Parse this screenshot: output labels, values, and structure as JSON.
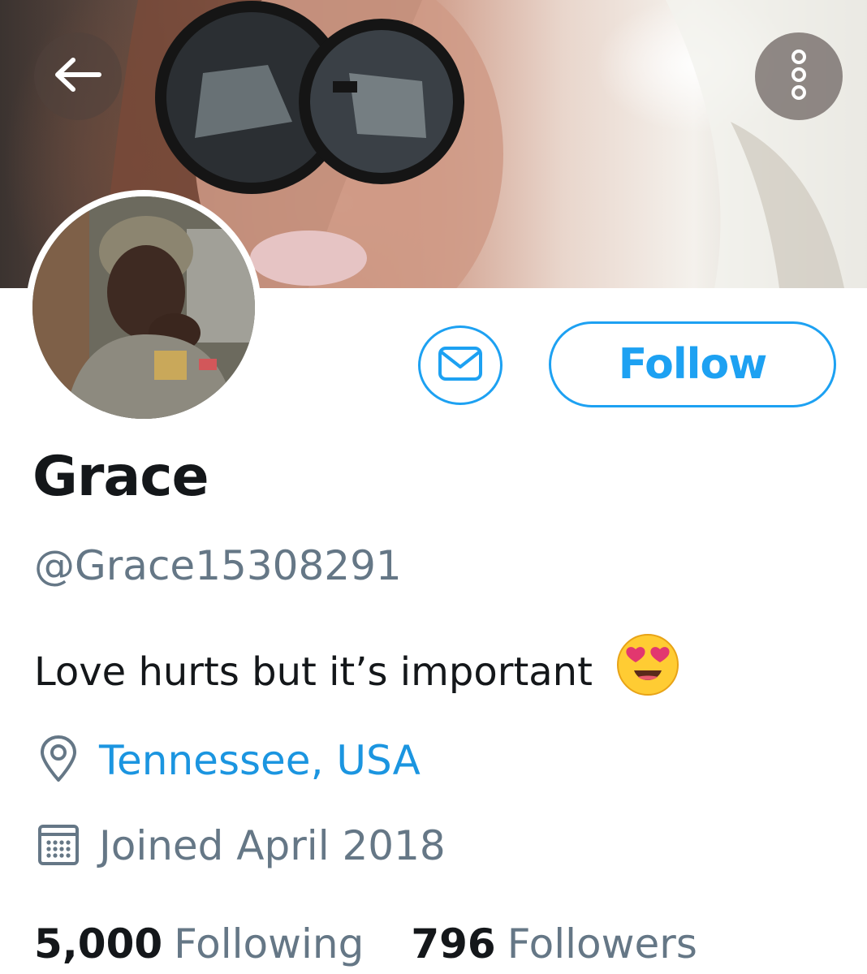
{
  "header": {
    "banner_image": "profile-banner-photo",
    "back_icon": "arrow-left-icon",
    "more_icon": "more-vertical-icon"
  },
  "profile": {
    "avatar_image": "profile-avatar-photo",
    "name": "Grace",
    "handle": "@Grace15308291",
    "bio": "Love hurts but it’s important",
    "bio_emoji_icon": "heart-eyes-emoji-icon",
    "location": "Tennessee, USA",
    "location_icon": "location-pin-icon",
    "joined": "Joined April 2018",
    "joined_icon": "calendar-icon"
  },
  "actions": {
    "message_icon": "envelope-icon",
    "follow_label": "Follow"
  },
  "stats": {
    "following_count": "5,000",
    "following_label": "Following",
    "followers_count": "796",
    "followers_label": "Followers"
  },
  "colors": {
    "accent": "#1da1f2",
    "link": "#1b95e0",
    "primary_text": "#14171a",
    "secondary_text": "#657786"
  }
}
